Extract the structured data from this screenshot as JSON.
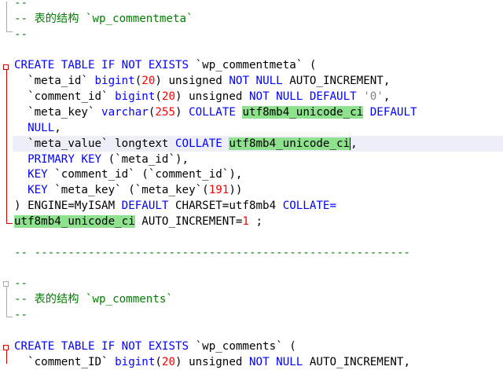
{
  "editor": {
    "lines": [
      {
        "tokens": [
          {
            "t": "--",
            "c": "cmt"
          }
        ]
      },
      {
        "tokens": [
          {
            "t": "-- 表的结构 `wp_commentmeta`",
            "c": "cmt"
          }
        ]
      },
      {
        "tokens": [
          {
            "t": "--",
            "c": "cmt"
          }
        ]
      },
      {
        "tokens": []
      },
      {
        "tokens": [
          {
            "t": "CREATE TABLE IF NOT EXISTS",
            "c": "kw"
          },
          {
            "t": " `wp_commentmeta` ("
          }
        ]
      },
      {
        "tokens": [
          {
            "t": "  `meta_id` "
          },
          {
            "t": "bigint",
            "c": "kw"
          },
          {
            "t": "("
          },
          {
            "t": "20",
            "c": "num"
          },
          {
            "t": ") unsigned "
          },
          {
            "t": "NOT NULL",
            "c": "kw"
          },
          {
            "t": " AUTO_INCREMENT,"
          }
        ]
      },
      {
        "tokens": [
          {
            "t": "  `comment_id` "
          },
          {
            "t": "bigint",
            "c": "kw"
          },
          {
            "t": "("
          },
          {
            "t": "20",
            "c": "num"
          },
          {
            "t": ") unsigned "
          },
          {
            "t": "NOT NULL DEFAULT",
            "c": "kw"
          },
          {
            "t": " "
          },
          {
            "t": "'0'",
            "c": "str"
          },
          {
            "t": ","
          }
        ]
      },
      {
        "tokens": [
          {
            "t": "  `meta_key` "
          },
          {
            "t": "varchar",
            "c": "kw"
          },
          {
            "t": "("
          },
          {
            "t": "255",
            "c": "num"
          },
          {
            "t": ") "
          },
          {
            "t": "COLLATE",
            "c": "kw"
          },
          {
            "t": " "
          },
          {
            "t": "utf8mb4_unicode_ci",
            "c": "hl"
          },
          {
            "t": " "
          },
          {
            "t": "DEFAULT",
            "c": "kw"
          }
        ]
      },
      {
        "tokens": [
          {
            "t": "  "
          },
          {
            "t": "NULL",
            "c": "kw"
          },
          {
            "t": ","
          }
        ]
      },
      {
        "current": true,
        "tokens": [
          {
            "t": "  `meta_value` longtext "
          },
          {
            "t": "COLLATE",
            "c": "kw"
          },
          {
            "t": " "
          },
          {
            "t": "utf8mb4_unicode_ci",
            "c": "hl caret"
          },
          {
            "t": ","
          }
        ]
      },
      {
        "tokens": [
          {
            "t": "  "
          },
          {
            "t": "PRIMARY KEY",
            "c": "kw"
          },
          {
            "t": " (`meta_id`),"
          }
        ]
      },
      {
        "tokens": [
          {
            "t": "  "
          },
          {
            "t": "KEY",
            "c": "kw"
          },
          {
            "t": " `comment_id` (`comment_id`),"
          }
        ]
      },
      {
        "tokens": [
          {
            "t": "  "
          },
          {
            "t": "KEY",
            "c": "kw"
          },
          {
            "t": " `meta_key` (`meta_key`("
          },
          {
            "t": "191",
            "c": "num"
          },
          {
            "t": "))"
          }
        ]
      },
      {
        "tokens": [
          {
            "t": ") ENGINE=MyISAM "
          },
          {
            "t": "DEFAULT",
            "c": "kw"
          },
          {
            "t": " CHARSET=utf8mb4 "
          },
          {
            "t": "COLLATE",
            "c": "kw"
          },
          {
            "t": "=",
            "c": "kw"
          }
        ]
      },
      {
        "tokens": [
          {
            "t": "utf8mb4_unicode_ci",
            "c": "hl"
          },
          {
            "t": " AUTO_INCREMENT="
          },
          {
            "t": "1",
            "c": "num"
          },
          {
            "t": " ;"
          }
        ]
      },
      {
        "tokens": []
      },
      {
        "tokens": [
          {
            "t": "-- --------------------------------------------------------",
            "c": "cmt"
          }
        ]
      },
      {
        "tokens": []
      },
      {
        "tokens": [
          {
            "t": "--",
            "c": "cmt"
          }
        ]
      },
      {
        "tokens": [
          {
            "t": "-- 表的结构 `wp_comments`",
            "c": "cmt"
          }
        ]
      },
      {
        "tokens": [
          {
            "t": "--",
            "c": "cmt"
          }
        ]
      },
      {
        "tokens": []
      },
      {
        "tokens": [
          {
            "t": "CREATE TABLE IF NOT EXISTS",
            "c": "kw"
          },
          {
            "t": " `wp_comments` ("
          }
        ]
      },
      {
        "tokens": [
          {
            "t": "  `comment_ID` "
          },
          {
            "t": "bigint",
            "c": "kw"
          },
          {
            "t": "("
          },
          {
            "t": "20",
            "c": "num"
          },
          {
            "t": ") unsigned "
          },
          {
            "t": "NOT NULL",
            "c": "kw"
          },
          {
            "t": " AUTO_INCREMENT,"
          }
        ]
      }
    ]
  }
}
